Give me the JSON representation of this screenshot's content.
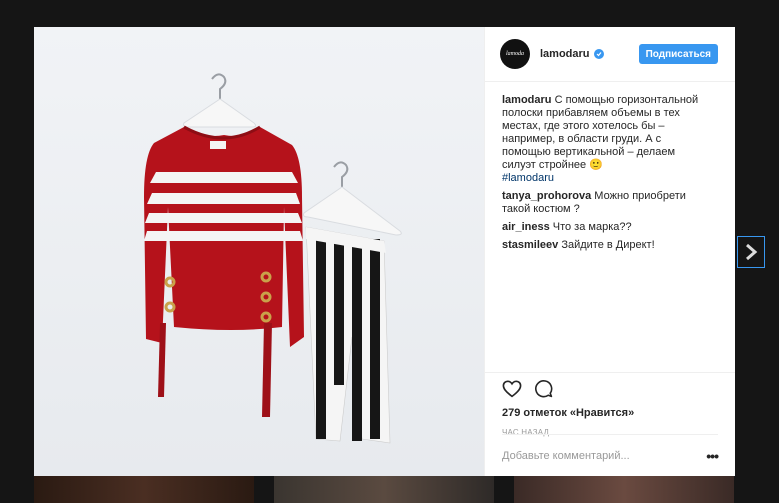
{
  "post": {
    "username": "lamodaru",
    "avatar_text": "lamoda",
    "follow_label": "Подписаться",
    "caption_user": "lamodaru",
    "caption_text": " С помощью горизонтальной полоски прибавляем объемы в тех местах, где этого хотелось бы – например, в области груди. А с помощью вертикальной – делаем силуэт стройнее 🙂",
    "hashtag": "#lamodaru",
    "comments": [
      {
        "user": "tanya_prohorova",
        "text": " Можно приобрети такой костюм ?"
      },
      {
        "user": "air_iness",
        "text": " Что за марка??"
      },
      {
        "user": "stasmileev",
        "text": " Зайдите в Директ!"
      }
    ],
    "likes": "279 отметок «Нравится»",
    "timestamp": "час назад",
    "comment_placeholder": "Добавьте комментарий..."
  },
  "icons": {
    "like": "heart-icon",
    "comment": "comment-icon",
    "more": "more-icon",
    "next": "chevron-right-icon",
    "verified": "verified-badge-icon"
  },
  "colors": {
    "accent": "#3897f0",
    "sweater": "#b5121b",
    "hashtag": "#003569"
  }
}
